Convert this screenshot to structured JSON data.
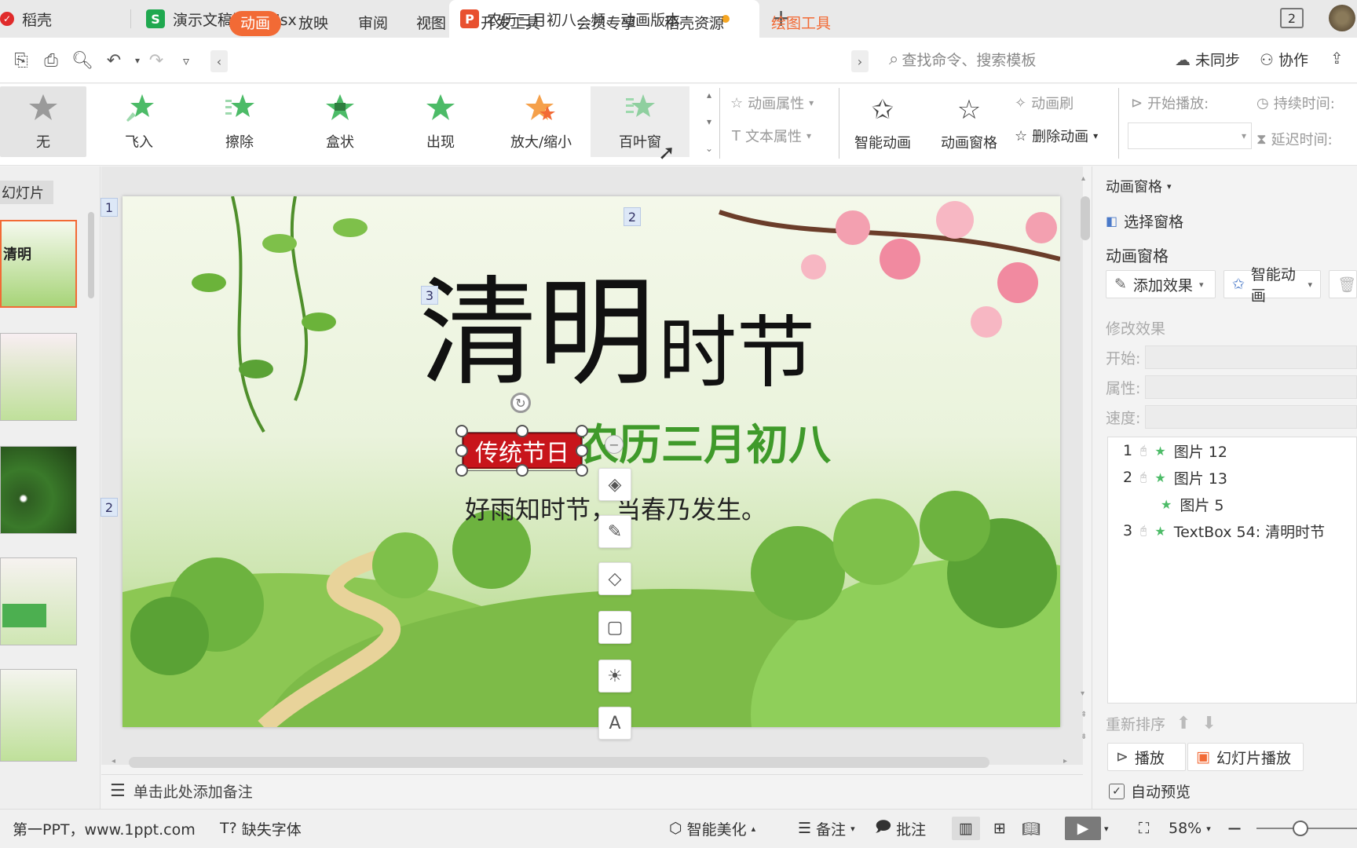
{
  "tabs": [
    {
      "label": "稻壳",
      "icon": "wps-icon",
      "color": "#e02b2b"
    },
    {
      "label": "演示文稿流程.xlsx",
      "icon": "S",
      "color": "#1fa84f"
    },
    {
      "label": "农历三月初八...频、动画版本",
      "icon": "P",
      "color": "#e8502f"
    }
  ],
  "window_badge": "2",
  "menu": {
    "items": [
      "动画",
      "放映",
      "审阅",
      "视图",
      "开发工具",
      "会员专享",
      "稻壳资源",
      "绘图工具"
    ],
    "active": "动画",
    "search_placeholder": "查找命令、搜索模板",
    "sync": "未同步",
    "collab": "协作"
  },
  "ribbon": {
    "animations": [
      "无",
      "飞入",
      "擦除",
      "盒状",
      "出现",
      "放大/缩小",
      "百叶窗"
    ],
    "anim_props": "动画属性",
    "text_props": "文本属性",
    "smart_anim": "智能动画",
    "anim_pane": "动画窗格",
    "anim_brush": "动画刷",
    "delete_anim": "删除动画",
    "start_play": "开始播放:",
    "duration": "持续时间:",
    "delay": "延迟时间:"
  },
  "left_panel": {
    "header": "幻灯片"
  },
  "slide": {
    "title_big": "清明",
    "title_small": "时节",
    "tag": "传统节日",
    "subtitle": "农历三月初八",
    "poem": "好雨知时节，当春乃发生。",
    "markers": [
      "1",
      "2",
      "3",
      "2"
    ]
  },
  "notes_placeholder": "单击此处添加备注",
  "right_pane": {
    "dropdown": "动画窗格",
    "select_pane": "选择窗格",
    "title": "动画窗格",
    "add_effect": "添加效果",
    "smart_anim": "智能动画",
    "modify": "修改效果",
    "start": "开始:",
    "property": "属性:",
    "speed": "速度:",
    "list": [
      {
        "num": "1",
        "name": "图片 12"
      },
      {
        "num": "2",
        "name": "图片 13"
      },
      {
        "num": "",
        "name": "图片 5"
      },
      {
        "num": "3",
        "name": "TextBox 54: 清明时节"
      }
    ],
    "reorder": "重新排序",
    "play": "播放",
    "slideshow": "幻灯片播放",
    "auto_preview": "自动预览"
  },
  "status": {
    "source": "第一PPT，www.1ppt.com",
    "missing_font": "缺失字体",
    "beautify": "智能美化",
    "notes": "备注",
    "comment": "批注",
    "zoom": "58%"
  }
}
